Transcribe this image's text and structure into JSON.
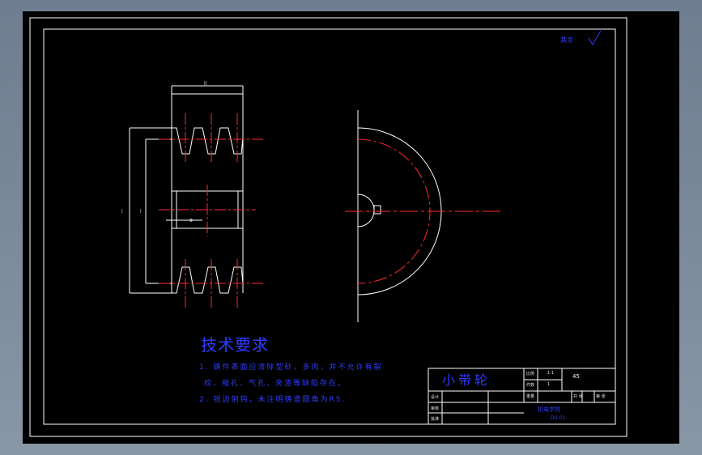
{
  "drawing": {
    "roughness_note": "其余",
    "tech_title": "技术要求",
    "tech_lines": [
      "1. 铸件表面应清除型砂，多肉，并不允许有裂",
      "纹、缩孔、气孔、夹渣等缺陷存在。",
      "2. 锐边倒钝，未注明铸造圆角为R5."
    ]
  },
  "title_block": {
    "part_name": "小带轮",
    "material": "45",
    "rows": [
      "设计",
      "审核",
      "批准"
    ],
    "cells": [
      "比例",
      "1:1",
      "件数",
      "1",
      "重量",
      "共 张",
      "第 张"
    ],
    "school": "机电学院",
    "dwg_no": "DS-01"
  },
  "colors": {
    "line": "#ffffff",
    "center": "#ff2a2a",
    "text": "#2d3cff"
  }
}
